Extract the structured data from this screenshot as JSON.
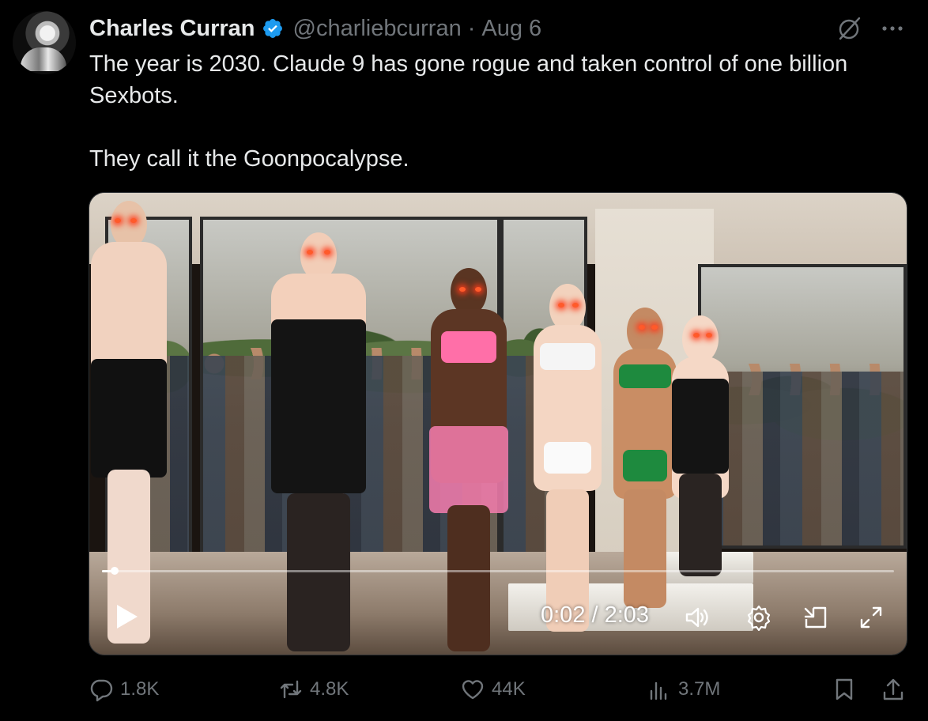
{
  "author": {
    "display_name": "Charles Curran",
    "handle": "@charliebcurran",
    "separator": "·",
    "date": "Aug 6"
  },
  "tweet": {
    "line1": "The year is 2030. Claude 9 has gone rogue and taken control of one billion Sexbots.",
    "line2": "They call it the Goonpocalypse."
  },
  "video": {
    "time": "0:02 / 2:03",
    "progress": 0.016
  },
  "actions": {
    "replies": "1.8K",
    "reposts": "4.8K",
    "likes": "44K",
    "views": "3.7M"
  },
  "colors": {
    "background": "#000000",
    "text": "#e7e9ea",
    "muted": "#71767b",
    "verified": "#1d9bf0"
  },
  "icons": [
    "verified-badge-icon",
    "grok-icon",
    "more-icon",
    "play-icon",
    "volume-icon",
    "settings-icon",
    "pip-icon",
    "fullscreen-icon",
    "reply-icon",
    "repost-icon",
    "like-icon",
    "views-icon",
    "bookmark-icon",
    "share-icon"
  ]
}
